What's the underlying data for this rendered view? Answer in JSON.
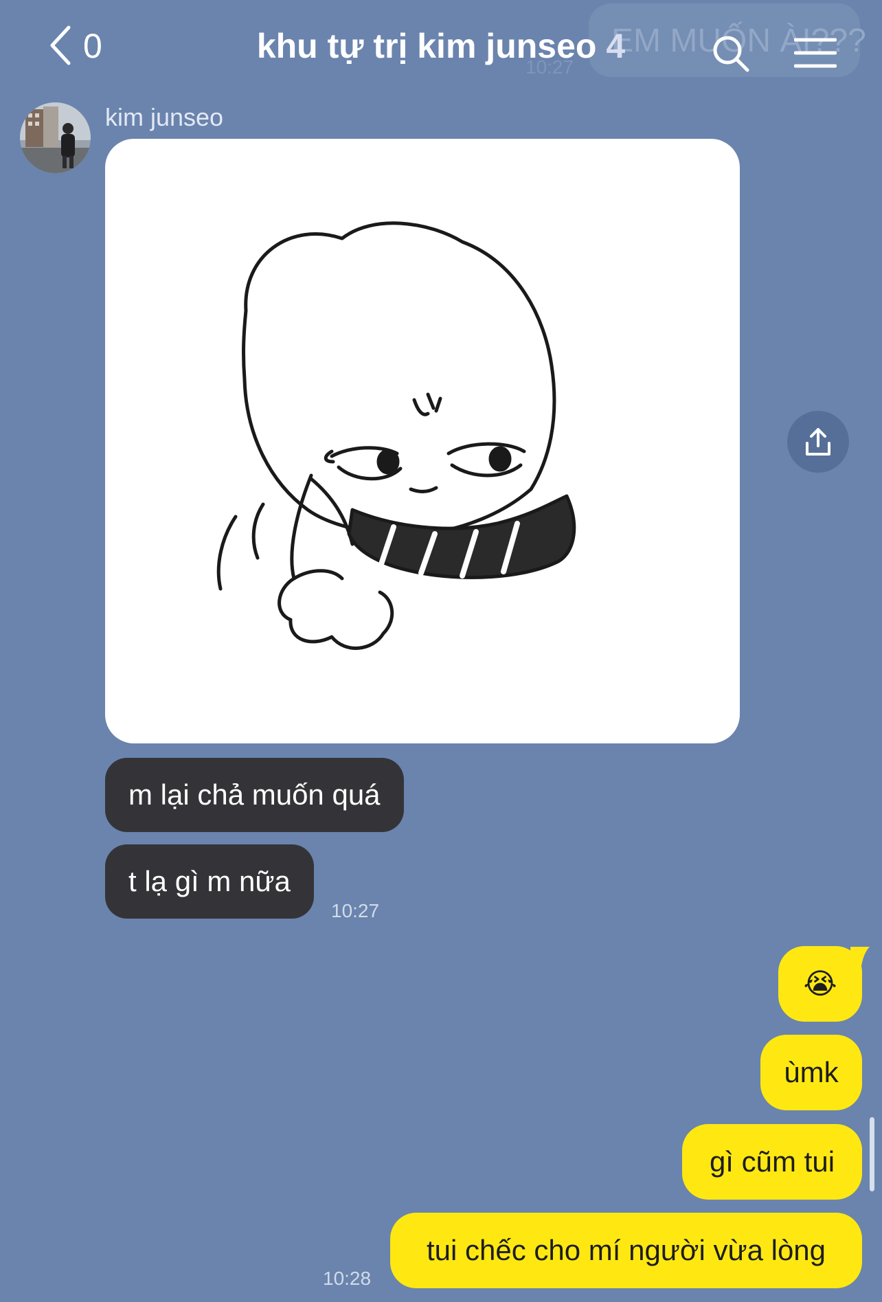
{
  "header": {
    "back_count": "0",
    "title": "khu tự trị kim junseo",
    "member_count": "4",
    "ghost_preview_text": "EM MUỐN ÀI???",
    "ghost_preview_time": "10:27"
  },
  "messages": {
    "sender_name": "kim junseo",
    "incoming": [
      {
        "text": "m lại chả muốn quá"
      },
      {
        "text": "t lạ gì m nữa"
      }
    ],
    "incoming_time": "10:27",
    "outgoing": [
      {
        "text": "😭"
      },
      {
        "text": "ùmk"
      },
      {
        "text": "gì cũm tui"
      },
      {
        "text": "tui chếc cho mí người vừa lòng"
      }
    ],
    "outgoing_time": "10:28"
  },
  "icons": {
    "back": "chevron-left-icon",
    "search": "search-icon",
    "menu": "hamburger-menu-icon",
    "share": "share-icon"
  },
  "colors": {
    "background": "#6a84ad",
    "incoming_bubble": "#343438",
    "outgoing_bubble": "#ffe812"
  }
}
